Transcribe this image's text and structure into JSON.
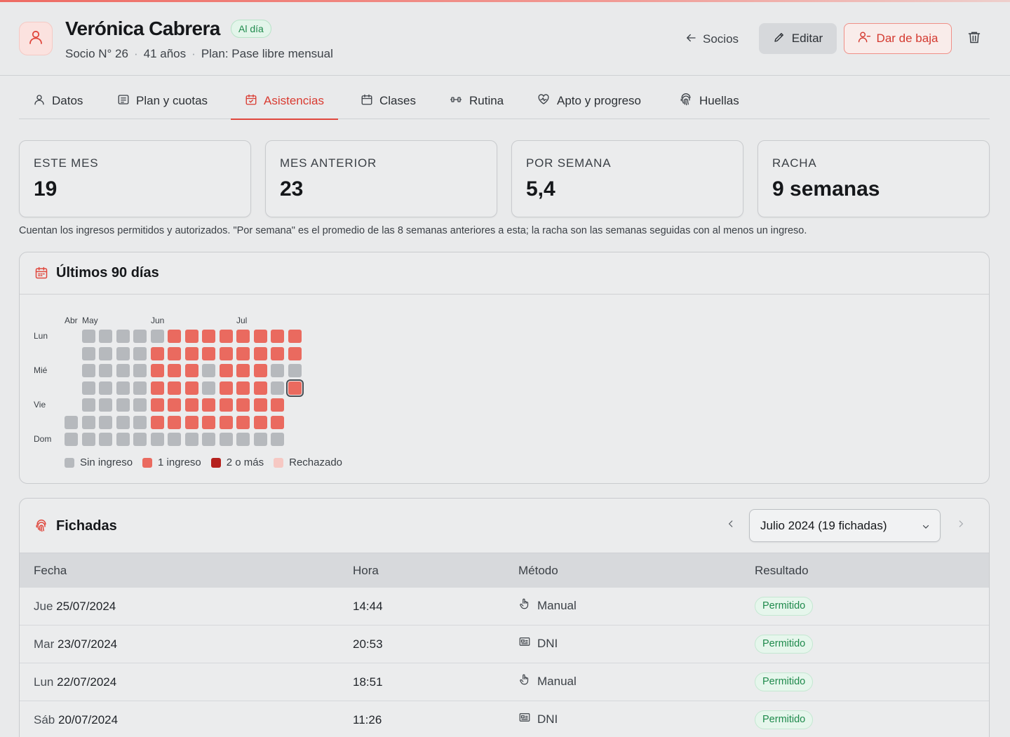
{
  "member": {
    "name": "Verónica Cabrera",
    "status": "Al día",
    "number": "Socio N° 26",
    "age": "41 años",
    "plan": "Plan: Pase libre mensual"
  },
  "actions": {
    "back_label": "Socios",
    "edit_label": "Editar",
    "unsubscribe_label": "Dar de baja"
  },
  "tabs": [
    {
      "label": "Datos",
      "icon": "user-icon"
    },
    {
      "label": "Plan y cuotas",
      "icon": "receipt-icon"
    },
    {
      "label": "Asistencias",
      "icon": "calendar-check-icon",
      "active": true
    },
    {
      "label": "Clases",
      "icon": "calendar-icon"
    },
    {
      "label": "Rutina",
      "icon": "dumbbell-icon"
    },
    {
      "label": "Apto y progreso",
      "icon": "heart-pulse-icon"
    },
    {
      "label": "Huellas",
      "icon": "fingerprint-icon"
    }
  ],
  "stats": [
    {
      "label": "ESTE MES",
      "value": "19"
    },
    {
      "label": "MES ANTERIOR",
      "value": "23"
    },
    {
      "label": "POR SEMANA",
      "value": "5,4"
    },
    {
      "label": "RACHA",
      "value": "9 semanas"
    }
  ],
  "note": "Cuentan los ingresos permitidos y autorizados. \"Por semana\" es el promedio de las 8 semanas anteriores a esta; la racha son las semanas seguidas con al menos un ingreso.",
  "heatmap": {
    "title": "Últimos 90 días",
    "months": [
      "Abr",
      "May",
      "Jun",
      "Jul"
    ],
    "days": [
      "Lun",
      "Mié",
      "Vie",
      "Dom"
    ],
    "legend": [
      "Sin ingreso",
      "1 ingreso",
      "2 o más",
      "Rechazado"
    ],
    "colors": {
      "none": "#b6b9bd",
      "one": "#ea6a5f",
      "two": "#b5211d",
      "rejected": "#f6c8c3"
    },
    "weeks": [
      [
        "x",
        "x",
        "x",
        "x",
        "x",
        "0",
        "0"
      ],
      [
        "0",
        "0",
        "0",
        "0",
        "0",
        "0",
        "0"
      ],
      [
        "0",
        "0",
        "0",
        "0",
        "0",
        "0",
        "0"
      ],
      [
        "0",
        "0",
        "0",
        "0",
        "0",
        "0",
        "0"
      ],
      [
        "0",
        "0",
        "0",
        "0",
        "0",
        "0",
        "0"
      ],
      [
        "0",
        "1",
        "1",
        "1",
        "1",
        "1",
        "0"
      ],
      [
        "1",
        "1",
        "1",
        "1",
        "1",
        "1",
        "0"
      ],
      [
        "1",
        "1",
        "1",
        "1",
        "1",
        "1",
        "0"
      ],
      [
        "1",
        "1",
        "0",
        "0",
        "1",
        "1",
        "0"
      ],
      [
        "1",
        "1",
        "1",
        "1",
        "1",
        "1",
        "0"
      ],
      [
        "1",
        "1",
        "1",
        "1",
        "1",
        "1",
        "0"
      ],
      [
        "1",
        "1",
        "1",
        "1",
        "1",
        "1",
        "0"
      ],
      [
        "1",
        "1",
        "0",
        "0",
        "1",
        "1",
        "0"
      ],
      [
        "1",
        "1",
        "0",
        "1",
        "x",
        "x",
        "x"
      ]
    ]
  },
  "fichadas": {
    "title": "Fichadas",
    "period": "Julio 2024 (19 fichadas)",
    "columns": [
      "Fecha",
      "Hora",
      "Método",
      "Resultado"
    ],
    "rows": [
      {
        "day": "Jue",
        "date": "25/07/2024",
        "time": "14:44",
        "method": "Manual",
        "method_icon": "hand-pointer-icon",
        "result": "Permitido"
      },
      {
        "day": "Mar",
        "date": "23/07/2024",
        "time": "20:53",
        "method": "DNI",
        "method_icon": "id-card-icon",
        "result": "Permitido"
      },
      {
        "day": "Lun",
        "date": "22/07/2024",
        "time": "18:51",
        "method": "Manual",
        "method_icon": "hand-pointer-icon",
        "result": "Permitido"
      },
      {
        "day": "Sáb",
        "date": "20/07/2024",
        "time": "11:26",
        "method": "DNI",
        "method_icon": "id-card-icon",
        "result": "Permitido"
      }
    ]
  }
}
